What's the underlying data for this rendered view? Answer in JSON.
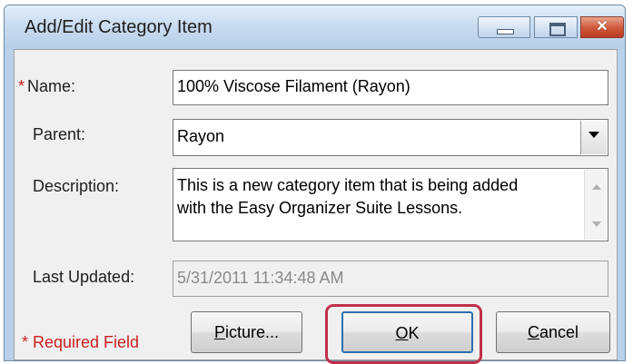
{
  "window": {
    "title": "Add/Edit Category Item",
    "controls": {
      "minimize_icon": "minimize-icon",
      "maximize_icon": "maximize-icon",
      "close_icon": "close-icon",
      "close_glyph": "✕"
    }
  },
  "form": {
    "name": {
      "required_marker": "*",
      "label": "Name:",
      "value": "100% Viscose Filament (Rayon)"
    },
    "parent": {
      "label": "Parent:",
      "value": "Rayon"
    },
    "description": {
      "label": "Description:",
      "lines": [
        "This is a new category item that is being added",
        "with the Easy Organizer Suite Lessons."
      ]
    },
    "last_updated": {
      "label": "Last Updated:",
      "value": "5/31/2011 11:34:48 AM"
    }
  },
  "footer": {
    "required_note": "* Required Field",
    "buttons": {
      "picture": {
        "mnemonic": "P",
        "rest": "icture..."
      },
      "ok": {
        "mnemonic": "O",
        "rest": "K"
      },
      "cancel": {
        "mnemonic": "C",
        "rest": "ancel"
      }
    }
  },
  "colors": {
    "required": "#cc2020",
    "highlight": "#c0304a",
    "title_bar": "#c9dcf0"
  }
}
